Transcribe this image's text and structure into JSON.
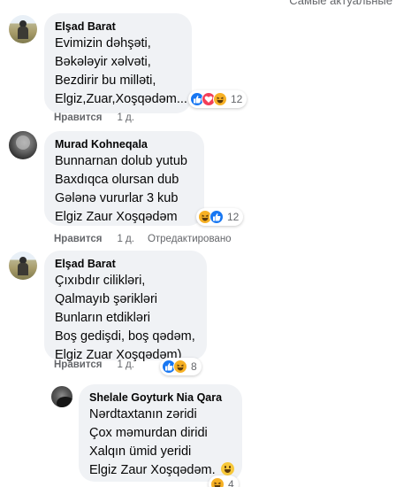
{
  "header": {
    "sort_label": "Самые актуальные"
  },
  "comments": [
    {
      "author": "Elşad Barat",
      "lines": [
        "Evimizin dəhşəti,",
        "Bəkələyir xəlvəti,",
        "Bezdirir bu milləti,",
        "Elgiz,Zuar,Xoşqədəm..."
      ],
      "reactions": [
        "like",
        "love",
        "haha"
      ],
      "reaction_count": "12",
      "like_label": "Нравится",
      "time": "1 д.",
      "edited": ""
    },
    {
      "author": "Murad Kohneqala",
      "lines": [
        "Bunnarnan dolub yutub",
        "Baxdıqca olursan dub",
        "Gələnə vururlar 3 kub",
        "Elgiz Zaur Xoşqədəm"
      ],
      "reactions": [
        "haha",
        "like"
      ],
      "reaction_count": "12",
      "like_label": "Нравится",
      "time": "1 д.",
      "edited": "Отредактировано"
    },
    {
      "author": "Elşad Barat",
      "lines": [
        "Çıxıbdır cilikləri,",
        "Qalmayıb şərikləri",
        "Bunların etdikləri",
        "Boş gedişdi, boş qədəm,",
        "Elgiz Zuar Xoşqədəm)"
      ],
      "reactions": [
        "like",
        "haha"
      ],
      "reaction_count": "8",
      "like_label": "Нравится",
      "time": "1 д.",
      "edited": ""
    },
    {
      "author": "Shelale Goyturk Nia Qara",
      "lines": [
        "Nərdtaxtanın zəridi",
        "Çox məmurdan diridi",
        "Xalqın ümid yeridi",
        "Elgiz Zaur Xoşqədəm."
      ],
      "reactions": [
        "haha"
      ],
      "reaction_count": "4",
      "like_label": "",
      "time": "",
      "edited": ""
    }
  ]
}
